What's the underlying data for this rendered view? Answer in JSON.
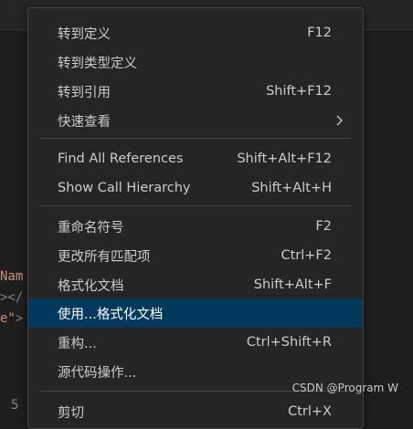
{
  "code": {
    "line1": "Nam",
    "line2": "></",
    "line3_str": "e\"",
    "line3_punc": ">",
    "line_number": "5"
  },
  "menu": {
    "items": [
      {
        "label": "转到定义",
        "shortcut": "F12"
      },
      {
        "label": "转到类型定义",
        "shortcut": ""
      },
      {
        "label": "转到引用",
        "shortcut": "Shift+F12"
      },
      {
        "label": "快速查看",
        "shortcut": "",
        "submenu": true
      },
      {
        "label": "Find All References",
        "shortcut": "Shift+Alt+F12"
      },
      {
        "label": "Show Call Hierarchy",
        "shortcut": "Shift+Alt+H"
      },
      {
        "label": "重命名符号",
        "shortcut": "F2"
      },
      {
        "label": "更改所有匹配项",
        "shortcut": "Ctrl+F2"
      },
      {
        "label": "格式化文档",
        "shortcut": "Shift+Alt+F"
      },
      {
        "label": "使用...格式化文档",
        "shortcut": "",
        "active": true
      },
      {
        "label": "重构...",
        "shortcut": "Ctrl+Shift+R"
      },
      {
        "label": "源代码操作...",
        "shortcut": ""
      },
      {
        "label": "剪切",
        "shortcut": "Ctrl+X"
      }
    ]
  },
  "watermark": "CSDN @Program W",
  "colors": {
    "menu_bg": "#252526",
    "active_bg": "#04395e",
    "text": "#cccccc"
  }
}
